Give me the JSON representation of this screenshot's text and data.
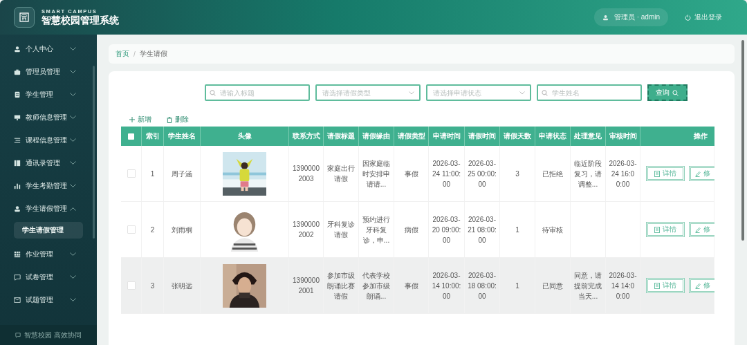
{
  "header": {
    "subtitle": "SMART CAMPUS",
    "title": "智慧校园管理系统",
    "user": "管理员 · admin",
    "logout": "退出登录"
  },
  "sidebar": {
    "items": [
      {
        "label": "个人中心",
        "expanded": false
      },
      {
        "label": "管理员管理",
        "expanded": false
      },
      {
        "label": "学生管理",
        "expanded": false
      },
      {
        "label": "教师信息管理",
        "expanded": false
      },
      {
        "label": "课程信息管理",
        "expanded": false
      },
      {
        "label": "通讯录管理",
        "expanded": false
      },
      {
        "label": "学生考勤管理",
        "expanded": false
      },
      {
        "label": "学生请假管理",
        "expanded": true,
        "children": [
          {
            "label": "学生请假管理",
            "selected": true
          }
        ]
      },
      {
        "label": "作业管理",
        "expanded": false
      },
      {
        "label": "试卷管理",
        "expanded": false
      },
      {
        "label": "试题管理",
        "expanded": false
      }
    ],
    "footer": "智慧校园 高效协同"
  },
  "breadcrumb": {
    "separator": "/",
    "items": [
      {
        "label": "首页",
        "kind": "link"
      },
      {
        "label": "学生请假",
        "kind": "current"
      }
    ]
  },
  "filters": [
    {
      "kind": "search",
      "placeholder": "请输入标题"
    },
    {
      "kind": "select",
      "placeholder": "请选择请假类型"
    },
    {
      "kind": "select",
      "placeholder": "请选择申请状态"
    },
    {
      "kind": "search",
      "placeholder": "学生姓名"
    }
  ],
  "search_button": "查询",
  "toolbar": [
    {
      "kind": "add",
      "label": "新增"
    },
    {
      "kind": "delete",
      "label": "删除"
    }
  ],
  "table": {
    "all_checked": false,
    "columns": [
      "索引",
      "学生姓名",
      "头像",
      "联系方式",
      "请假标题",
      "请假缘由",
      "请假类型",
      "申请时间",
      "请假时间",
      "请假天数",
      "申请状态",
      "处理意见",
      "审核时间",
      "操作"
    ],
    "rows": [
      {
        "checked": false,
        "highlighted": false,
        "index": "1",
        "name": "周子涵",
        "avatar": {
          "kind": "picture"
        },
        "phone": "13900002003",
        "title": "家庭出行请假",
        "reason": "因家庭临时安排申请请...",
        "type": "事假",
        "applied": "2026-03-24 11:00:00",
        "leave": "2026-03-25 00:00:00",
        "days": "3",
        "status": "已拒绝",
        "comment": "临近阶段复习，请调整...",
        "reviewed": "2026-03-24 16:00:00",
        "actions": [
          {
            "kind": "detail",
            "label": "详情"
          },
          {
            "kind": "edit",
            "label": "修"
          }
        ]
      },
      {
        "checked": false,
        "highlighted": false,
        "index": "2",
        "name": "刘雨桐",
        "avatar": {
          "kind": "picture"
        },
        "phone": "13900002002",
        "title": "牙科复诊请假",
        "reason": "预约进行牙科复诊，申...",
        "type": "病假",
        "applied": "2026-03-20 09:00:00",
        "leave": "2026-03-21 08:00:00",
        "days": "1",
        "status": "待审核",
        "actions": [
          {
            "kind": "detail",
            "label": "详情"
          },
          {
            "kind": "edit",
            "label": "修"
          }
        ]
      },
      {
        "checked": false,
        "highlighted": true,
        "index": "3",
        "name": "张明远",
        "avatar": {
          "kind": "picture"
        },
        "phone": "13900002001",
        "title": "参加市级朗诵比赛请假",
        "reason": "代表学校参加市级朗诵...",
        "type": "事假",
        "applied": "2026-03-14 10:00:00",
        "leave": "2026-03-18 08:00:00",
        "days": "1",
        "status": "已同意",
        "comment": "同意，请提前完成当天...",
        "reviewed": "2026-03-14 14:00:00",
        "actions": [
          {
            "kind": "detail",
            "label": "详情"
          },
          {
            "kind": "edit",
            "label": "修"
          }
        ]
      }
    ]
  }
}
